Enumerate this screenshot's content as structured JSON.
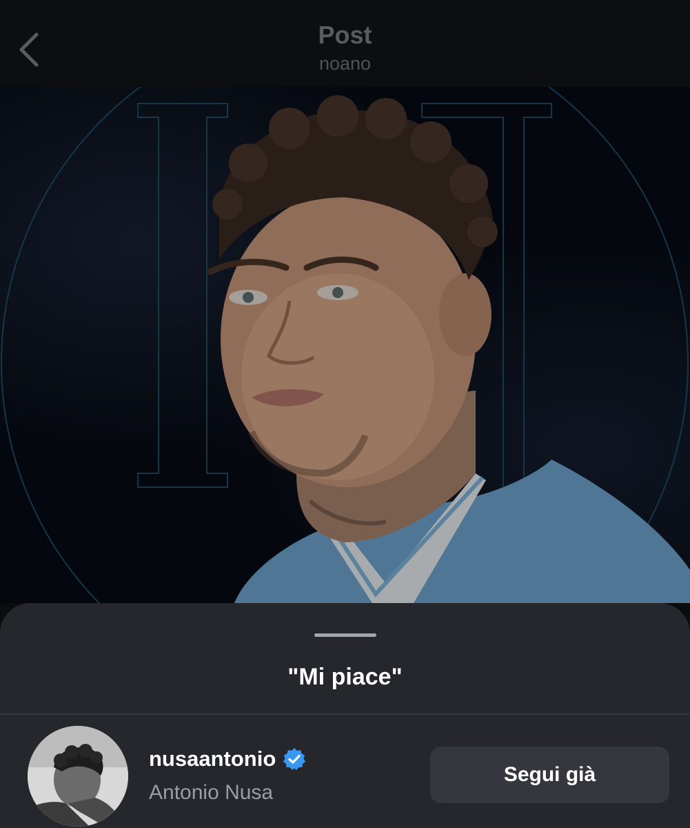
{
  "header": {
    "title": "Post",
    "subtitle": "noano",
    "back_icon": "chevron-left-icon"
  },
  "post": {
    "image_description": "portrait photo",
    "colors": {
      "background": "#060a12",
      "jersey": "#7fb6dc",
      "outline": "#2c5f80"
    }
  },
  "likes_sheet": {
    "title": "\"Mi piace\"",
    "users": [
      {
        "username": "nusaantonio",
        "full_name": "Antonio Nusa",
        "verified": true,
        "button_label": "Segui già"
      }
    ]
  },
  "colors": {
    "sheet_bg": "#25272c",
    "button_bg": "#34373d",
    "verified": "#3897f0"
  }
}
